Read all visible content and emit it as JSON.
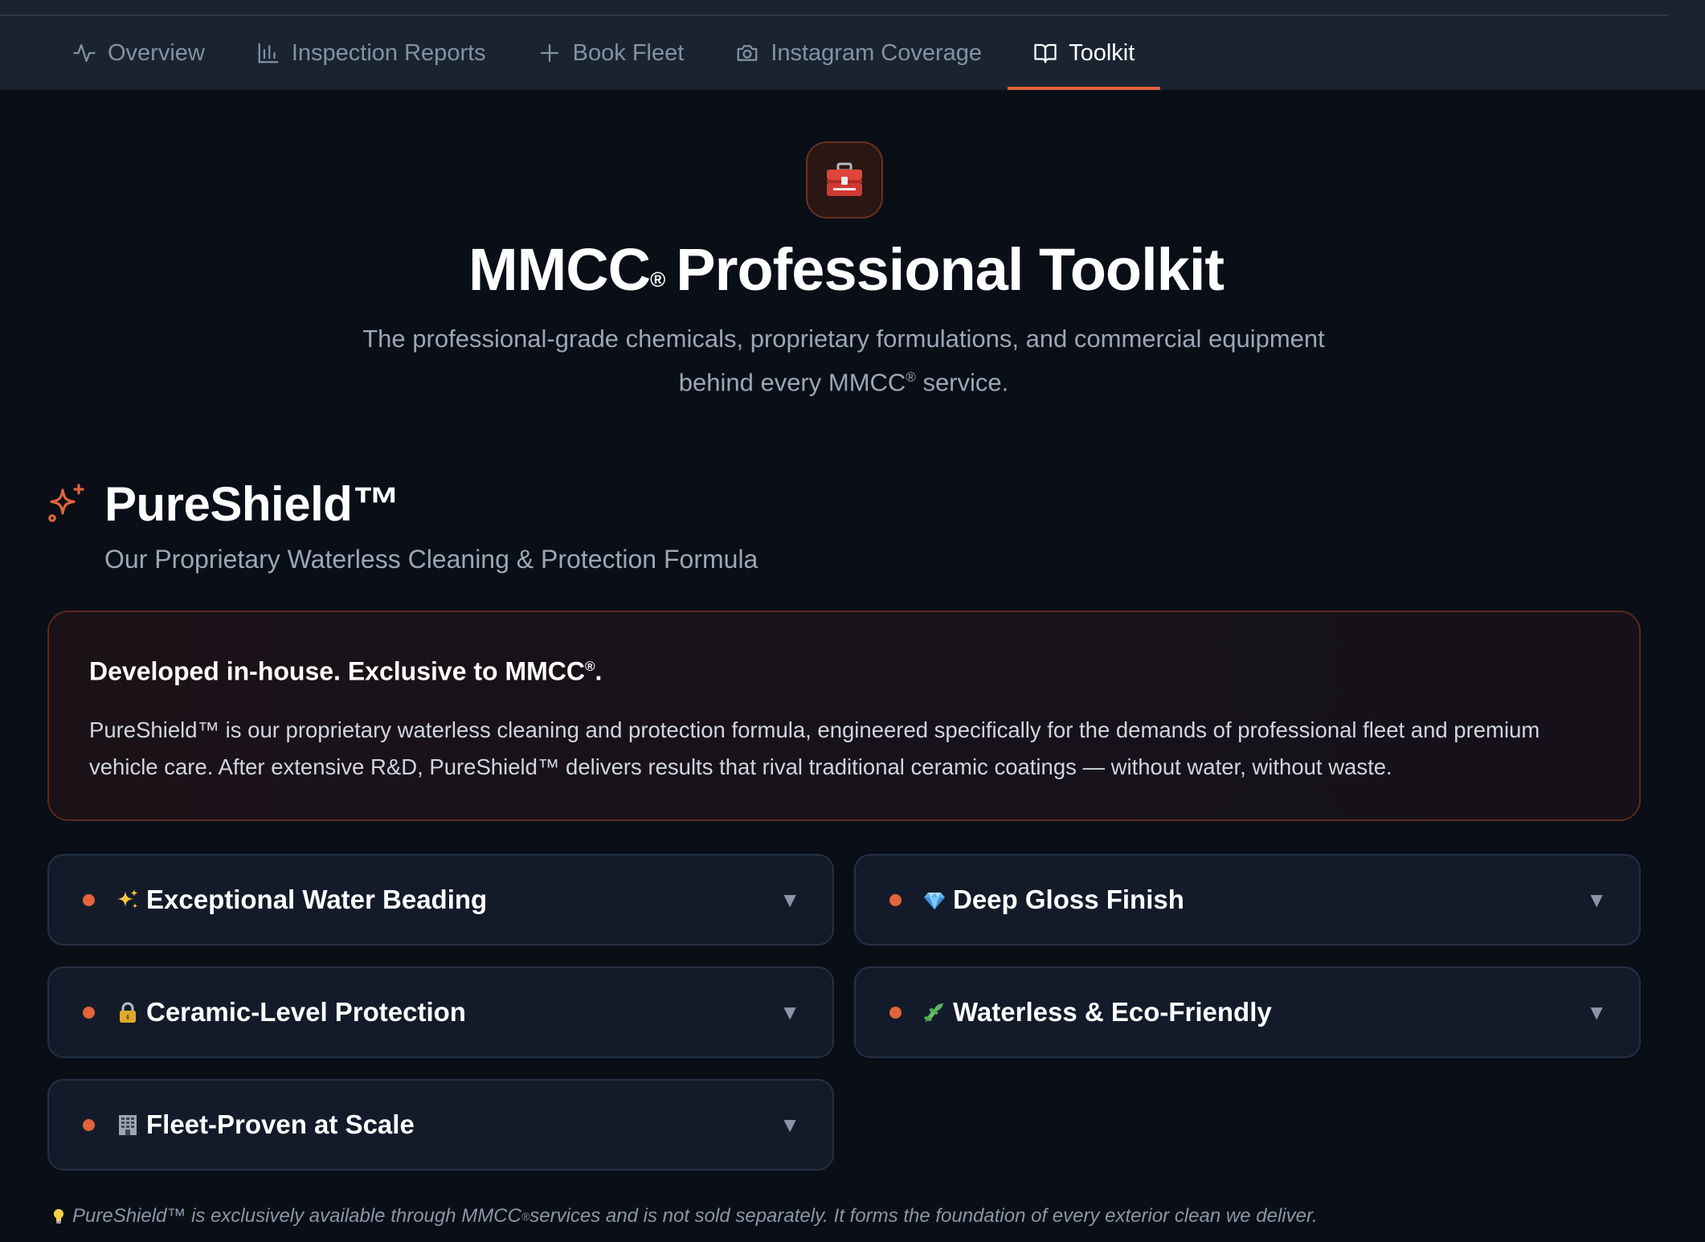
{
  "nav": {
    "tabs": [
      {
        "label": "Overview",
        "icon": "activity-icon",
        "active": false
      },
      {
        "label": "Inspection Reports",
        "icon": "bar-chart-icon",
        "active": false
      },
      {
        "label": "Book Fleet",
        "icon": "plus-icon",
        "active": false
      },
      {
        "label": "Instagram Coverage",
        "icon": "camera-icon",
        "active": false
      },
      {
        "label": "Toolkit",
        "icon": "book-open-icon",
        "active": true
      }
    ]
  },
  "hero": {
    "icon": "toolbox-icon",
    "brand": "MMCC",
    "registered": "®",
    "title_rest": "Professional Toolkit",
    "subtitle_line1": "The professional-grade chemicals, proprietary formulations, and commercial equipment",
    "subtitle_line2_pre": "behind every MMCC",
    "subtitle_line2_post": " service."
  },
  "section": {
    "icon": "sparkles-icon",
    "title": "PureShield™",
    "subtitle": "Our Proprietary Waterless Cleaning & Protection Formula"
  },
  "intro": {
    "heading_pre": "Developed in-house. Exclusive to MMCC",
    "heading_post": ".",
    "body": "PureShield™ is our proprietary waterless cleaning and protection formula, engineered specifically for the demands of professional fleet and premium vehicle care. After extensive R&D, PureShield™ delivers results that rival traditional ceramic coatings — without water, without waste."
  },
  "features": [
    {
      "label": "Exceptional Water Beading",
      "icon": "sparkles-emoji-icon"
    },
    {
      "label": "Deep Gloss Finish",
      "icon": "gem-emoji-icon"
    },
    {
      "label": "Ceramic-Level Protection",
      "icon": "lock-emoji-icon"
    },
    {
      "label": "Waterless & Eco-Friendly",
      "icon": "leaf-emoji-icon"
    },
    {
      "label": "Fleet-Proven at Scale",
      "icon": "office-building-emoji-icon"
    }
  ],
  "chevron": "▼",
  "footnote": {
    "icon": "lightbulb-icon",
    "pre": "PureShield™ is exclusively available through MMCC",
    "post": " services and is not sold separately. It forms the foundation of every exterior clean we deliver."
  },
  "colors": {
    "accent": "#e2643a",
    "background": "#0a0e17",
    "tabbar": "#1a2431",
    "card": "#131b2a"
  }
}
